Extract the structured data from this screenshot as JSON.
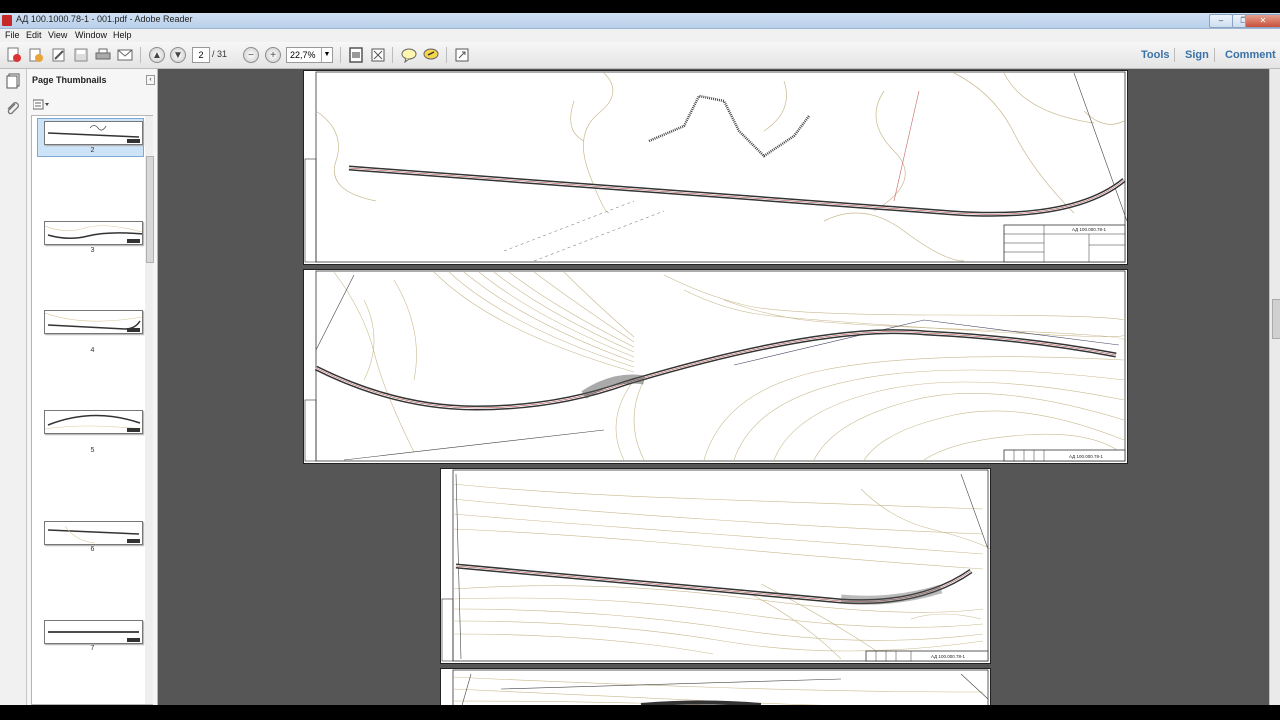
{
  "window": {
    "title": "АД 100.1000.78-1 - 001.pdf - Adobe Reader",
    "buttons": {
      "minimize": "–",
      "restore": "❐",
      "close": "✕"
    }
  },
  "menu": [
    "File",
    "Edit",
    "View",
    "Window",
    "Help"
  ],
  "toolbar": {
    "page_current": "2",
    "page_total": "/ 31",
    "zoom": "22,7%",
    "right_links": [
      "Tools",
      "Sign",
      "Comment"
    ]
  },
  "panel": {
    "title": "Page Thumbnails",
    "thumbnails": [
      {
        "label": "2",
        "selected": true
      },
      {
        "label": "3",
        "selected": false
      },
      {
        "label": "4",
        "selected": false
      },
      {
        "label": "5",
        "selected": false
      },
      {
        "label": "6",
        "selected": false
      },
      {
        "label": "7",
        "selected": false
      }
    ]
  },
  "document": {
    "stamp_text": "АД 100.000.78-1"
  },
  "colors": {
    "accent": "#3a72a8",
    "contour": "#c9b98f",
    "road": "#333333"
  }
}
